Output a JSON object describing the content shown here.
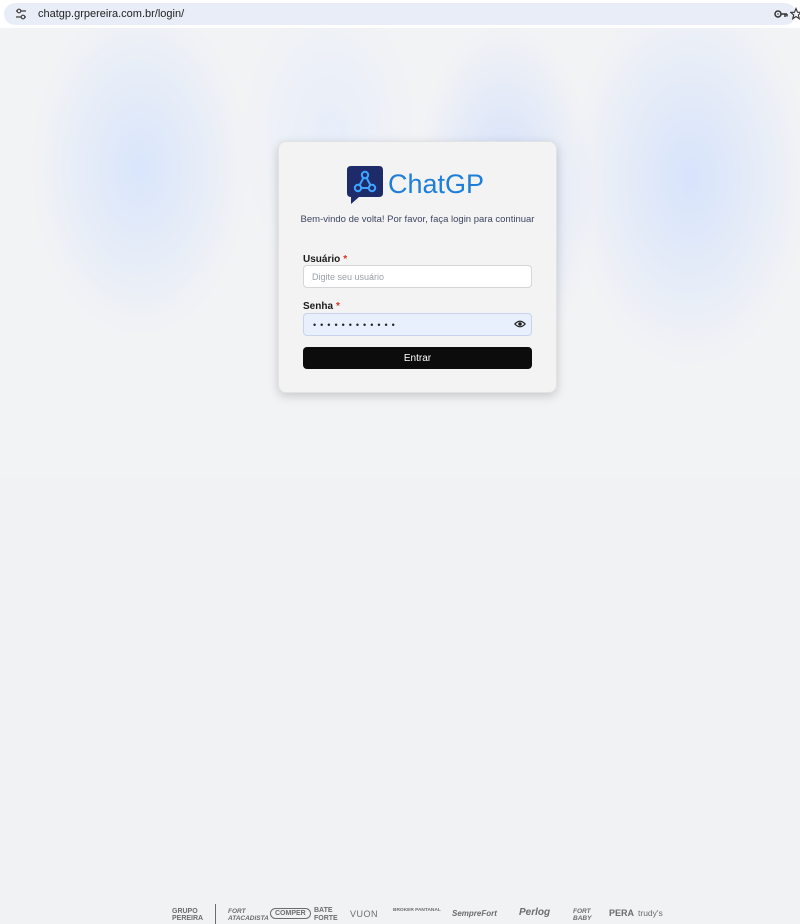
{
  "browser": {
    "url": "chatgp.grpereira.com.br/login/",
    "icons": [
      "site-info-icon",
      "key-icon",
      "star-icon"
    ]
  },
  "login": {
    "brand": "ChatGP",
    "welcome": "Bem-vindo de volta! Por favor, faça login para continuar",
    "username_label": "Usuário",
    "username_placeholder": "Digite seu usuário",
    "username_value": "",
    "password_label": "Senha",
    "password_mask": "••••••••••••",
    "required_mark": "*",
    "submit_label": "Entrar"
  },
  "colors": {
    "brand": "#1f7fd8",
    "logo_bg": "#1d2b6b",
    "button": "#0c0c0c",
    "required": "#d93025",
    "autofill": "#e8f0fe"
  },
  "partners": [
    "GRUPO PEREIRA",
    "FORT ATACADISTA",
    "COMPER",
    "BATE FORTE",
    "VUON",
    "BROKER PANTANAL",
    "SempreFort",
    "Perlog",
    "FORT BABY",
    "PERA",
    "trudy's"
  ]
}
